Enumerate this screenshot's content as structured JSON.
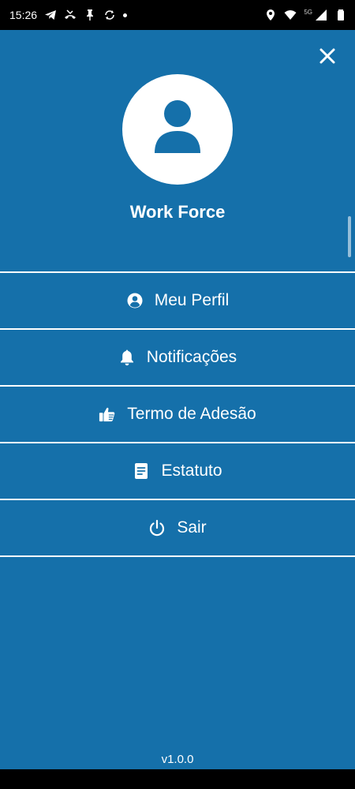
{
  "status_bar": {
    "time": "15:26",
    "network_label": "5G",
    "left_icons": [
      "telegram-icon",
      "missed-call-icon",
      "pin-icon",
      "sync-icon",
      "notification-dot-icon"
    ],
    "right_icons": [
      "location-icon",
      "wifi-icon",
      "cellular-signal-icon",
      "battery-icon"
    ]
  },
  "drawer": {
    "background_color": "#1570AA",
    "close_icon": "close-icon",
    "avatar_icon": "person-icon",
    "user_name": "Work Force",
    "menu": [
      {
        "icon": "account-circle-icon",
        "label": "Meu Perfil"
      },
      {
        "icon": "bell-icon",
        "label": "Notificações"
      },
      {
        "icon": "thumbs-up-icon",
        "label": "Termo de Adesão"
      },
      {
        "icon": "document-icon",
        "label": "Estatuto"
      },
      {
        "icon": "power-icon",
        "label": "Sair"
      }
    ],
    "version": "v1.0.0"
  }
}
